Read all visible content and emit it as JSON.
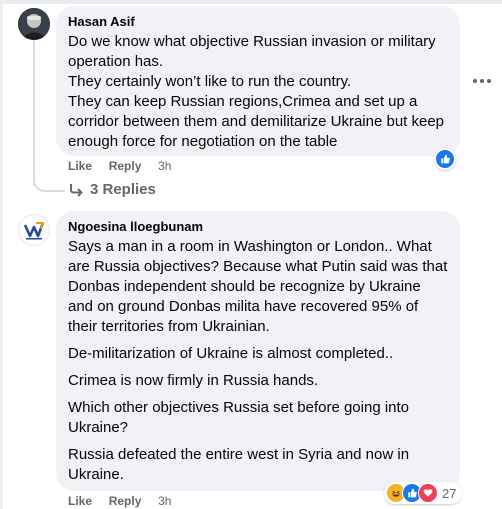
{
  "comments": [
    {
      "author": "Hasan Asif",
      "paragraphs": [
        "Do we know what objective Russian invasion or military operation has.\nThey certainly won’t like to run the country.\nThey can keep Russian regions,Crimea and set up a corridor between them and demilitarize Ukraine but keep enough force for negotiation on the table"
      ],
      "actions": {
        "like": "Like",
        "reply": "Reply",
        "time": "3h"
      },
      "replies_label": "3 Replies",
      "reactions": [
        "like-reaction-icon"
      ]
    },
    {
      "author": "Ngoesina lloegbunam",
      "paragraphs": [
        "Says a man in a room in Washington or London.. What are Russia objectives? Because what Putin said was that Donbas independent should be recognize by Ukraine and on ground Donbas milita have recovered 95% of their territories from Ukrainian.",
        "De-militarization of Ukraine is almost completed..",
        "Crimea is now firmly in Russia hands.",
        "Which other objectives Russia set before going into Ukraine?",
        "Russia defeated the entire west in Syria and now in Ukraine."
      ],
      "actions": {
        "like": "Like",
        "reply": "Reply",
        "time": "3h"
      },
      "reactions": [
        "haha-reaction-icon",
        "like-reaction-icon",
        "love-reaction-icon"
      ],
      "reaction_count": "27"
    }
  ],
  "colors": {
    "bubble": "#f0f2f5",
    "secondary_text": "#65676b",
    "like_blue": "#1877f2",
    "love_red": "#f33e58",
    "haha_yellow": "#f7b125"
  }
}
